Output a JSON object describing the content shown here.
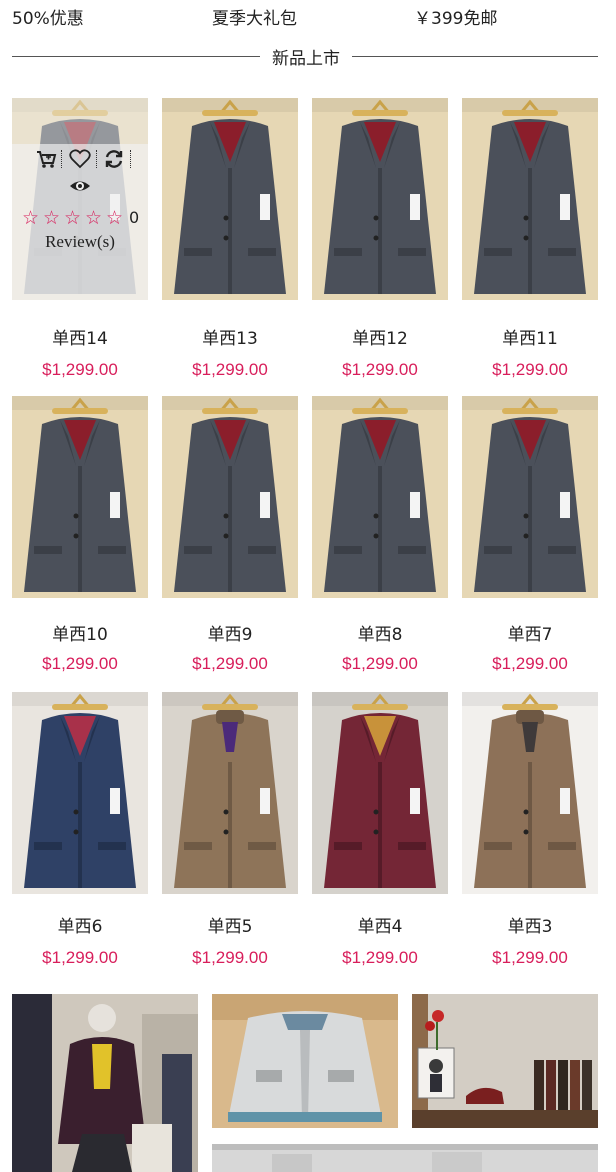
{
  "promo": {
    "items": [
      "50%优惠",
      "夏季大礼包",
      "￥399免邮"
    ]
  },
  "section": {
    "title": "新品上市"
  },
  "quickview": {
    "review_count": "0",
    "review_label": "Review(s)",
    "stars": [
      "☆",
      "☆",
      "☆",
      "☆",
      "☆"
    ]
  },
  "products": [
    {
      "name": "单西14",
      "price": "$1,299.00"
    },
    {
      "name": "单西13",
      "price": "$1,299.00"
    },
    {
      "name": "单西12",
      "price": "$1,299.00"
    },
    {
      "name": "单西11",
      "price": "$1,299.00"
    },
    {
      "name": "单西10",
      "price": "$1,299.00"
    },
    {
      "name": "单西9",
      "price": "$1,299.00"
    },
    {
      "name": "单西8",
      "price": "$1,299.00"
    },
    {
      "name": "单西7",
      "price": "$1,299.00"
    },
    {
      "name": "单西6",
      "price": "$1,299.00"
    },
    {
      "name": "单西5",
      "price": "$1,299.00"
    },
    {
      "name": "单西4",
      "price": "$1,299.00"
    },
    {
      "name": "单西3",
      "price": "$1,299.00"
    }
  ],
  "colors": {
    "price": "#d81e5b",
    "star": "#d81e5b",
    "text": "#222222"
  }
}
